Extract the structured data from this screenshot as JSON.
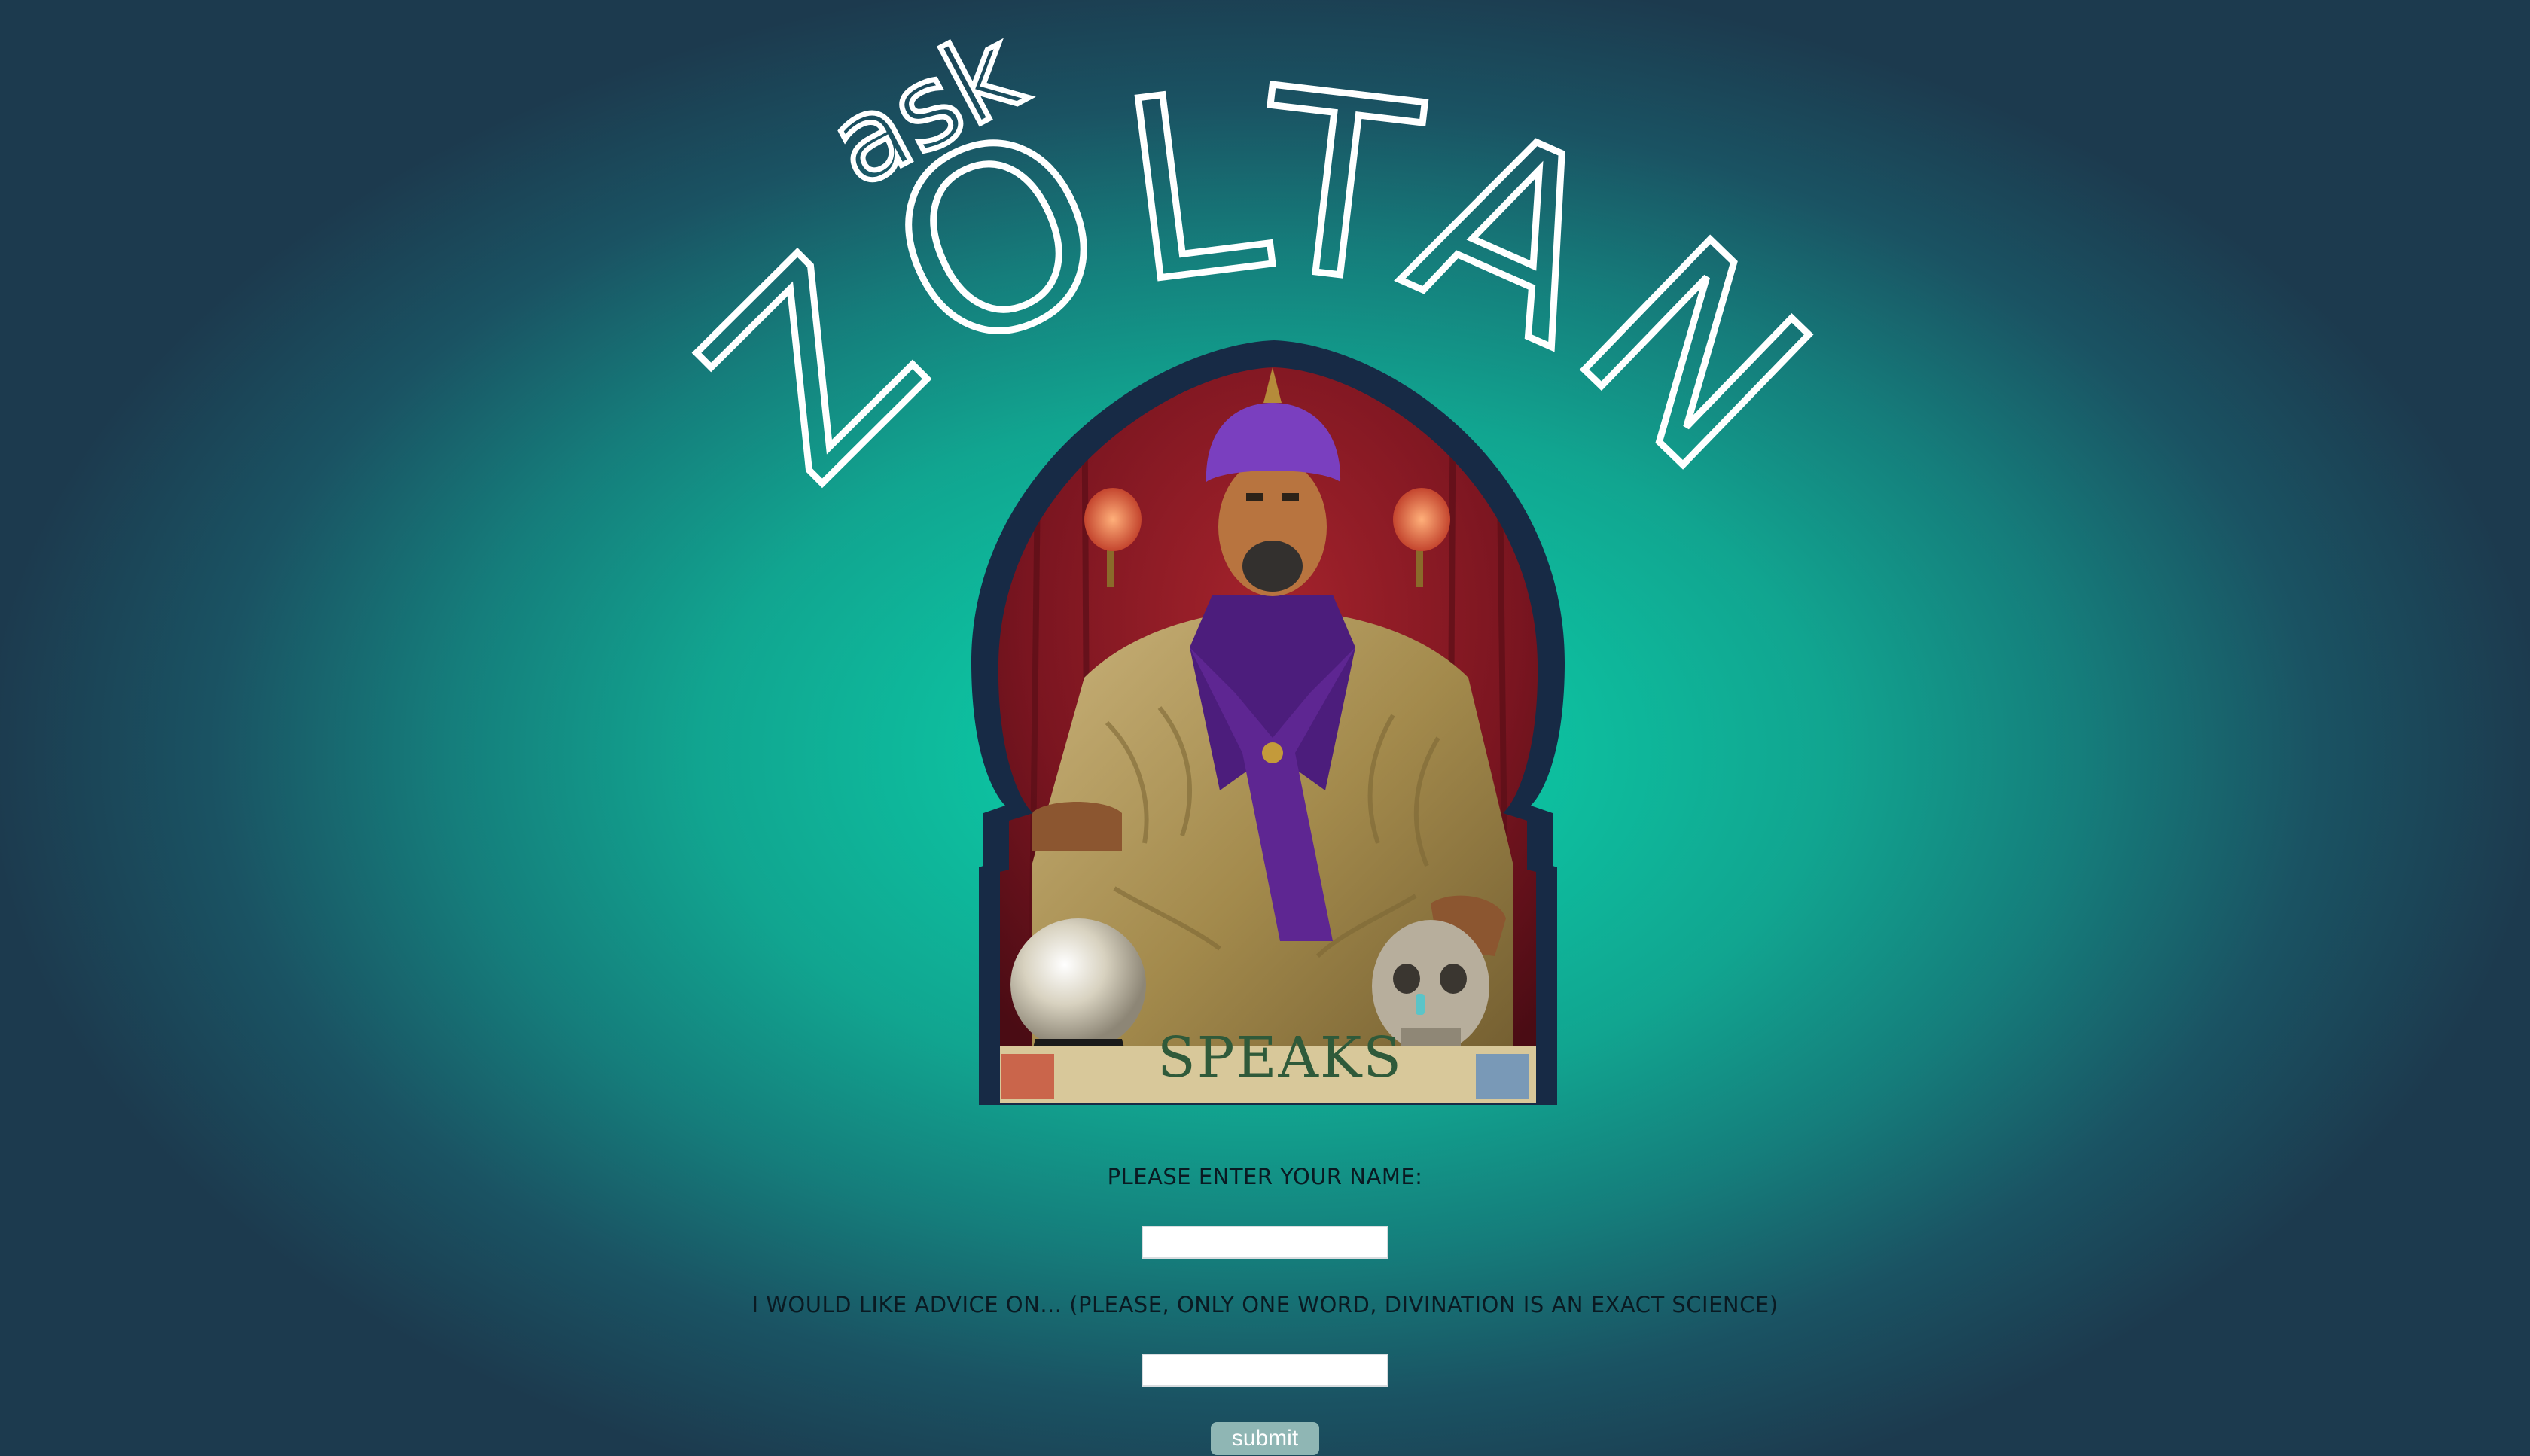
{
  "logo": {
    "word_ask": "ask",
    "word_name": "ZOLTAN"
  },
  "portrait": {
    "table_sign_text": "SPEAKS"
  },
  "form": {
    "name_label": "PLEASE ENTER YOUR NAME:",
    "name_value": "",
    "advice_label": "I WOULD LIKE ADVICE ON... (PLEASE, ONLY ONE WORD, DIVINATION IS AN EXACT SCIENCE)",
    "advice_value": "",
    "submit_label": "submit"
  },
  "colors": {
    "background_center": "#0ccfa8",
    "background_edge": "#1c3a4e",
    "frame": "#172a45",
    "logo_text": "#ffffff",
    "label_text": "#0a1a22",
    "submit_button": "#8fb6b4"
  }
}
